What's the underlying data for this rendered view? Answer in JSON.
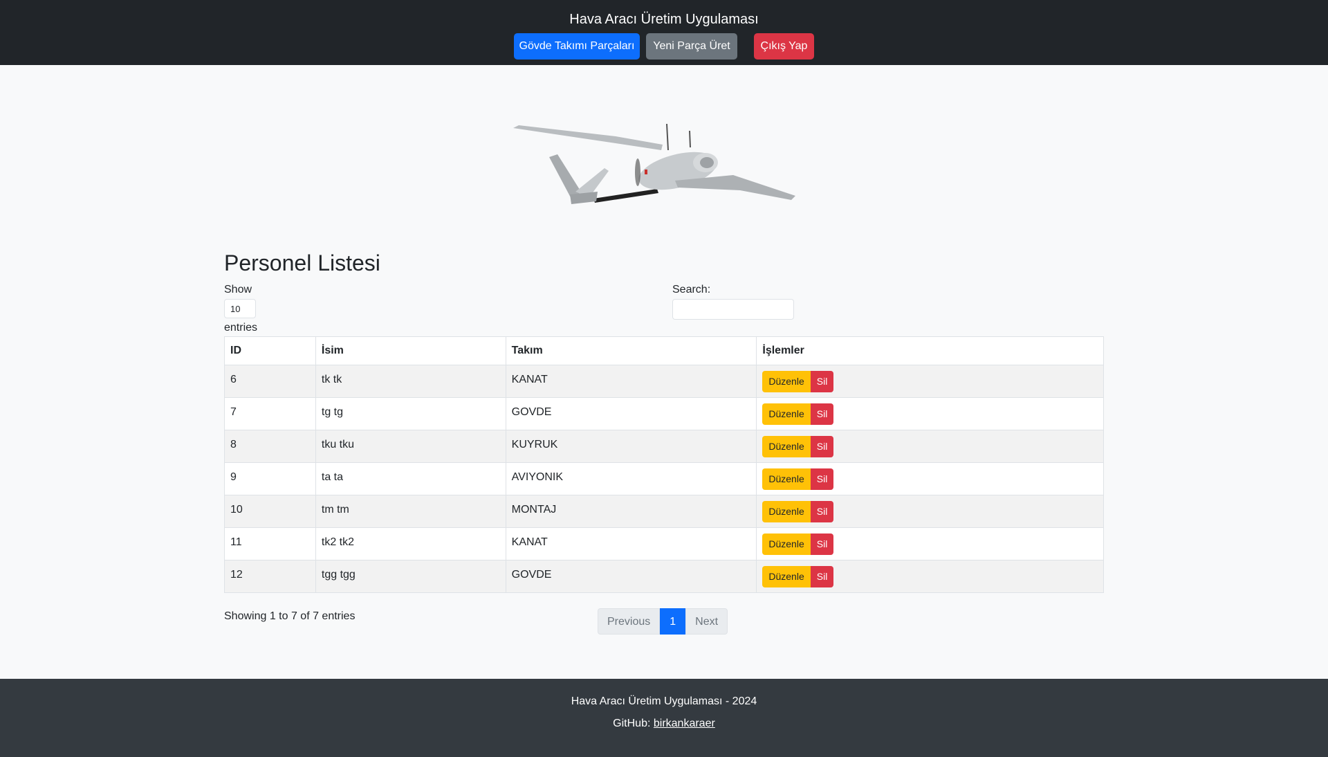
{
  "header": {
    "title": "Hava Aracı Üretim Uygulaması",
    "buttons": {
      "parts": "Gövde Takımı Parçaları",
      "produce": "Yeni Parça Üret",
      "logout": "Çıkış Yap"
    }
  },
  "hero": {
    "icon": "uav-drone-image"
  },
  "main": {
    "title": "Personel Listesi",
    "length": {
      "show_label": "Show",
      "value": "10",
      "entries_label": "entries"
    },
    "search": {
      "label": "Search:",
      "value": ""
    },
    "table": {
      "columns": [
        "ID",
        "İsim",
        "Takım",
        "İşlemler"
      ],
      "rows": [
        {
          "id": "6",
          "name": "tk tk",
          "team": "KANAT"
        },
        {
          "id": "7",
          "name": "tg tg",
          "team": "GOVDE"
        },
        {
          "id": "8",
          "name": "tku tku",
          "team": "KUYRUK"
        },
        {
          "id": "9",
          "name": "ta ta",
          "team": "AVIYONIK"
        },
        {
          "id": "10",
          "name": "tm tm",
          "team": "MONTAJ"
        },
        {
          "id": "11",
          "name": "tk2 tk2",
          "team": "KANAT"
        },
        {
          "id": "12",
          "name": "tgg tgg",
          "team": "GOVDE"
        }
      ],
      "edit_label": "Düzenle",
      "delete_label": "Sil"
    },
    "info": "Showing 1 to 7 of 7 entries",
    "pagination": {
      "previous": "Previous",
      "current": "1",
      "next": "Next"
    }
  },
  "footer": {
    "line1": "Hava Aracı Üretim Uygulaması - 2024",
    "github_label": "GitHub:",
    "github_link": "birkankaraer"
  },
  "colors": {
    "navbar": "#212529",
    "footer": "#343a40",
    "primary": "#0d6efd",
    "secondary": "#6c757d",
    "danger": "#dc3545",
    "warning": "#ffc107"
  }
}
